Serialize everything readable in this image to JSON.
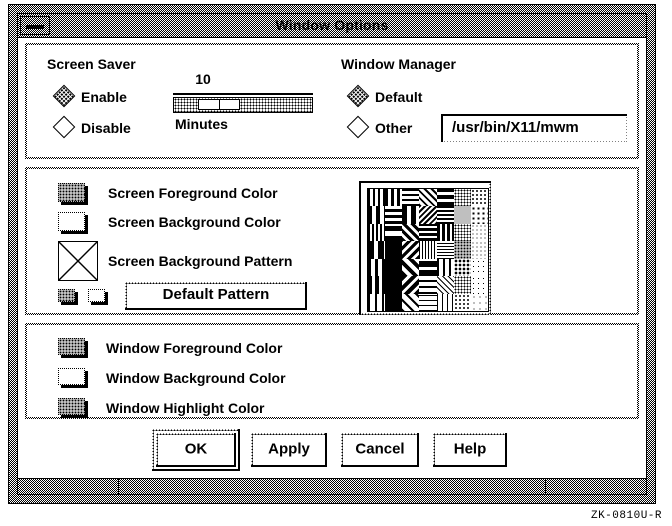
{
  "window": {
    "title": "Window Options",
    "menu_button_icon": "window-menu-icon"
  },
  "screen_saver": {
    "title": "Screen Saver",
    "options": [
      {
        "label": "Enable",
        "selected": true
      },
      {
        "label": "Disable",
        "selected": false
      }
    ],
    "slider": {
      "value": "10",
      "units_label": "Minutes",
      "position_percent": 25
    }
  },
  "window_manager": {
    "title": "Window Manager",
    "options": [
      {
        "label": "Default",
        "selected": true
      },
      {
        "label": "Other",
        "selected": false
      }
    ],
    "path_field": {
      "value": "/usr/bin/X11/mwm",
      "placeholder": "/usr/bin/X11/mwm"
    }
  },
  "screen_group": {
    "rows": [
      {
        "label": "Screen Foreground Color",
        "swatch": "filled"
      },
      {
        "label": "Screen Background Color",
        "swatch": "empty"
      },
      {
        "label": "Screen Background Pattern",
        "swatch": "pattern"
      }
    ],
    "default_pattern_button": "Default Pattern",
    "mini_swatches": [
      {
        "swatch": "filled"
      },
      {
        "swatch": "empty"
      }
    ]
  },
  "window_group": {
    "rows": [
      {
        "label": "Window Foreground Color",
        "swatch": "filled"
      },
      {
        "label": "Window Background Color",
        "swatch": "empty"
      },
      {
        "label": "Window Highlight Color",
        "swatch": "filled"
      }
    ]
  },
  "buttons": [
    {
      "label": "OK",
      "default": true
    },
    {
      "label": "Apply",
      "default": false
    },
    {
      "label": "Cancel",
      "default": false
    },
    {
      "label": "Help",
      "default": false
    }
  ],
  "caption": "ZK-0810U-R",
  "colors": {
    "foreground": "#000000",
    "background": "#ffffff",
    "frame": "#808080"
  }
}
